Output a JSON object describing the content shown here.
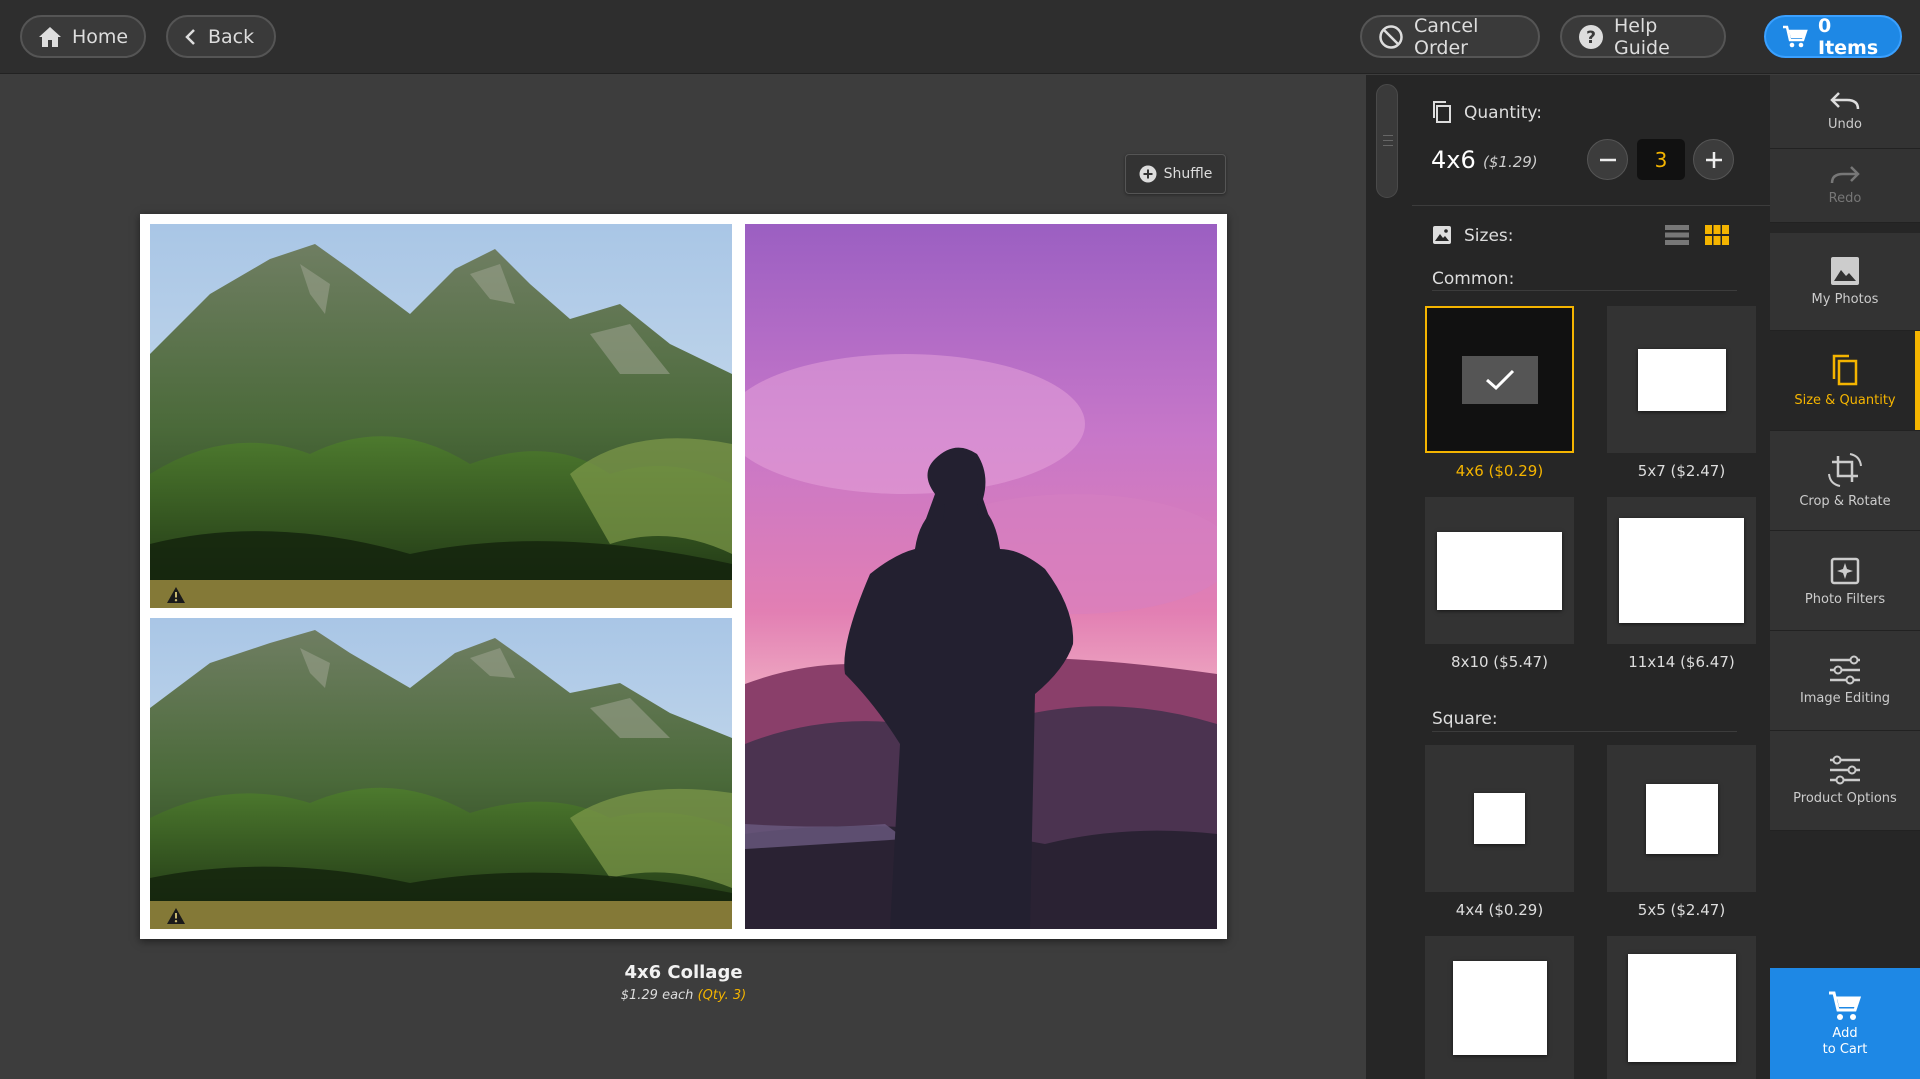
{
  "topbar": {
    "home_label": "Home",
    "back_label": "Back",
    "cancel_label": "Cancel Order",
    "help_label": "Help Guide",
    "cart_label": "0 Items"
  },
  "canvas": {
    "shuffle_label": "Shuffle",
    "caption_title": "4x6 Collage",
    "caption_each": "$1.29 each",
    "caption_qty": "(Qty. 3)"
  },
  "quantity": {
    "label": "Quantity:",
    "size": "4x6",
    "price": "($1.29)",
    "value": "3"
  },
  "sizes": {
    "label": "Sizes:",
    "common_label": "Common:",
    "square_label": "Square:",
    "common": [
      {
        "label": "4x6 ($0.29)",
        "selected": true
      },
      {
        "label": "5x7 ($2.47)",
        "selected": false
      },
      {
        "label": "8x10 ($5.47)",
        "selected": false
      },
      {
        "label": "11x14 ($6.47)",
        "selected": false
      }
    ],
    "square": [
      {
        "label": "4x4 ($0.29)"
      },
      {
        "label": "5x5 ($2.47)"
      }
    ]
  },
  "nav": {
    "undo": "Undo",
    "redo": "Redo",
    "my_photos": "My Photos",
    "size_quantity": "Size & Quantity",
    "crop_rotate": "Crop & Rotate",
    "photo_filters": "Photo Filters",
    "image_editing": "Image Editing",
    "product_options": "Product Options",
    "add_to_cart_1": "Add",
    "add_to_cart_2": "to Cart"
  },
  "colors": {
    "accent": "#f4b400",
    "cart_blue": "#1e88e5"
  }
}
